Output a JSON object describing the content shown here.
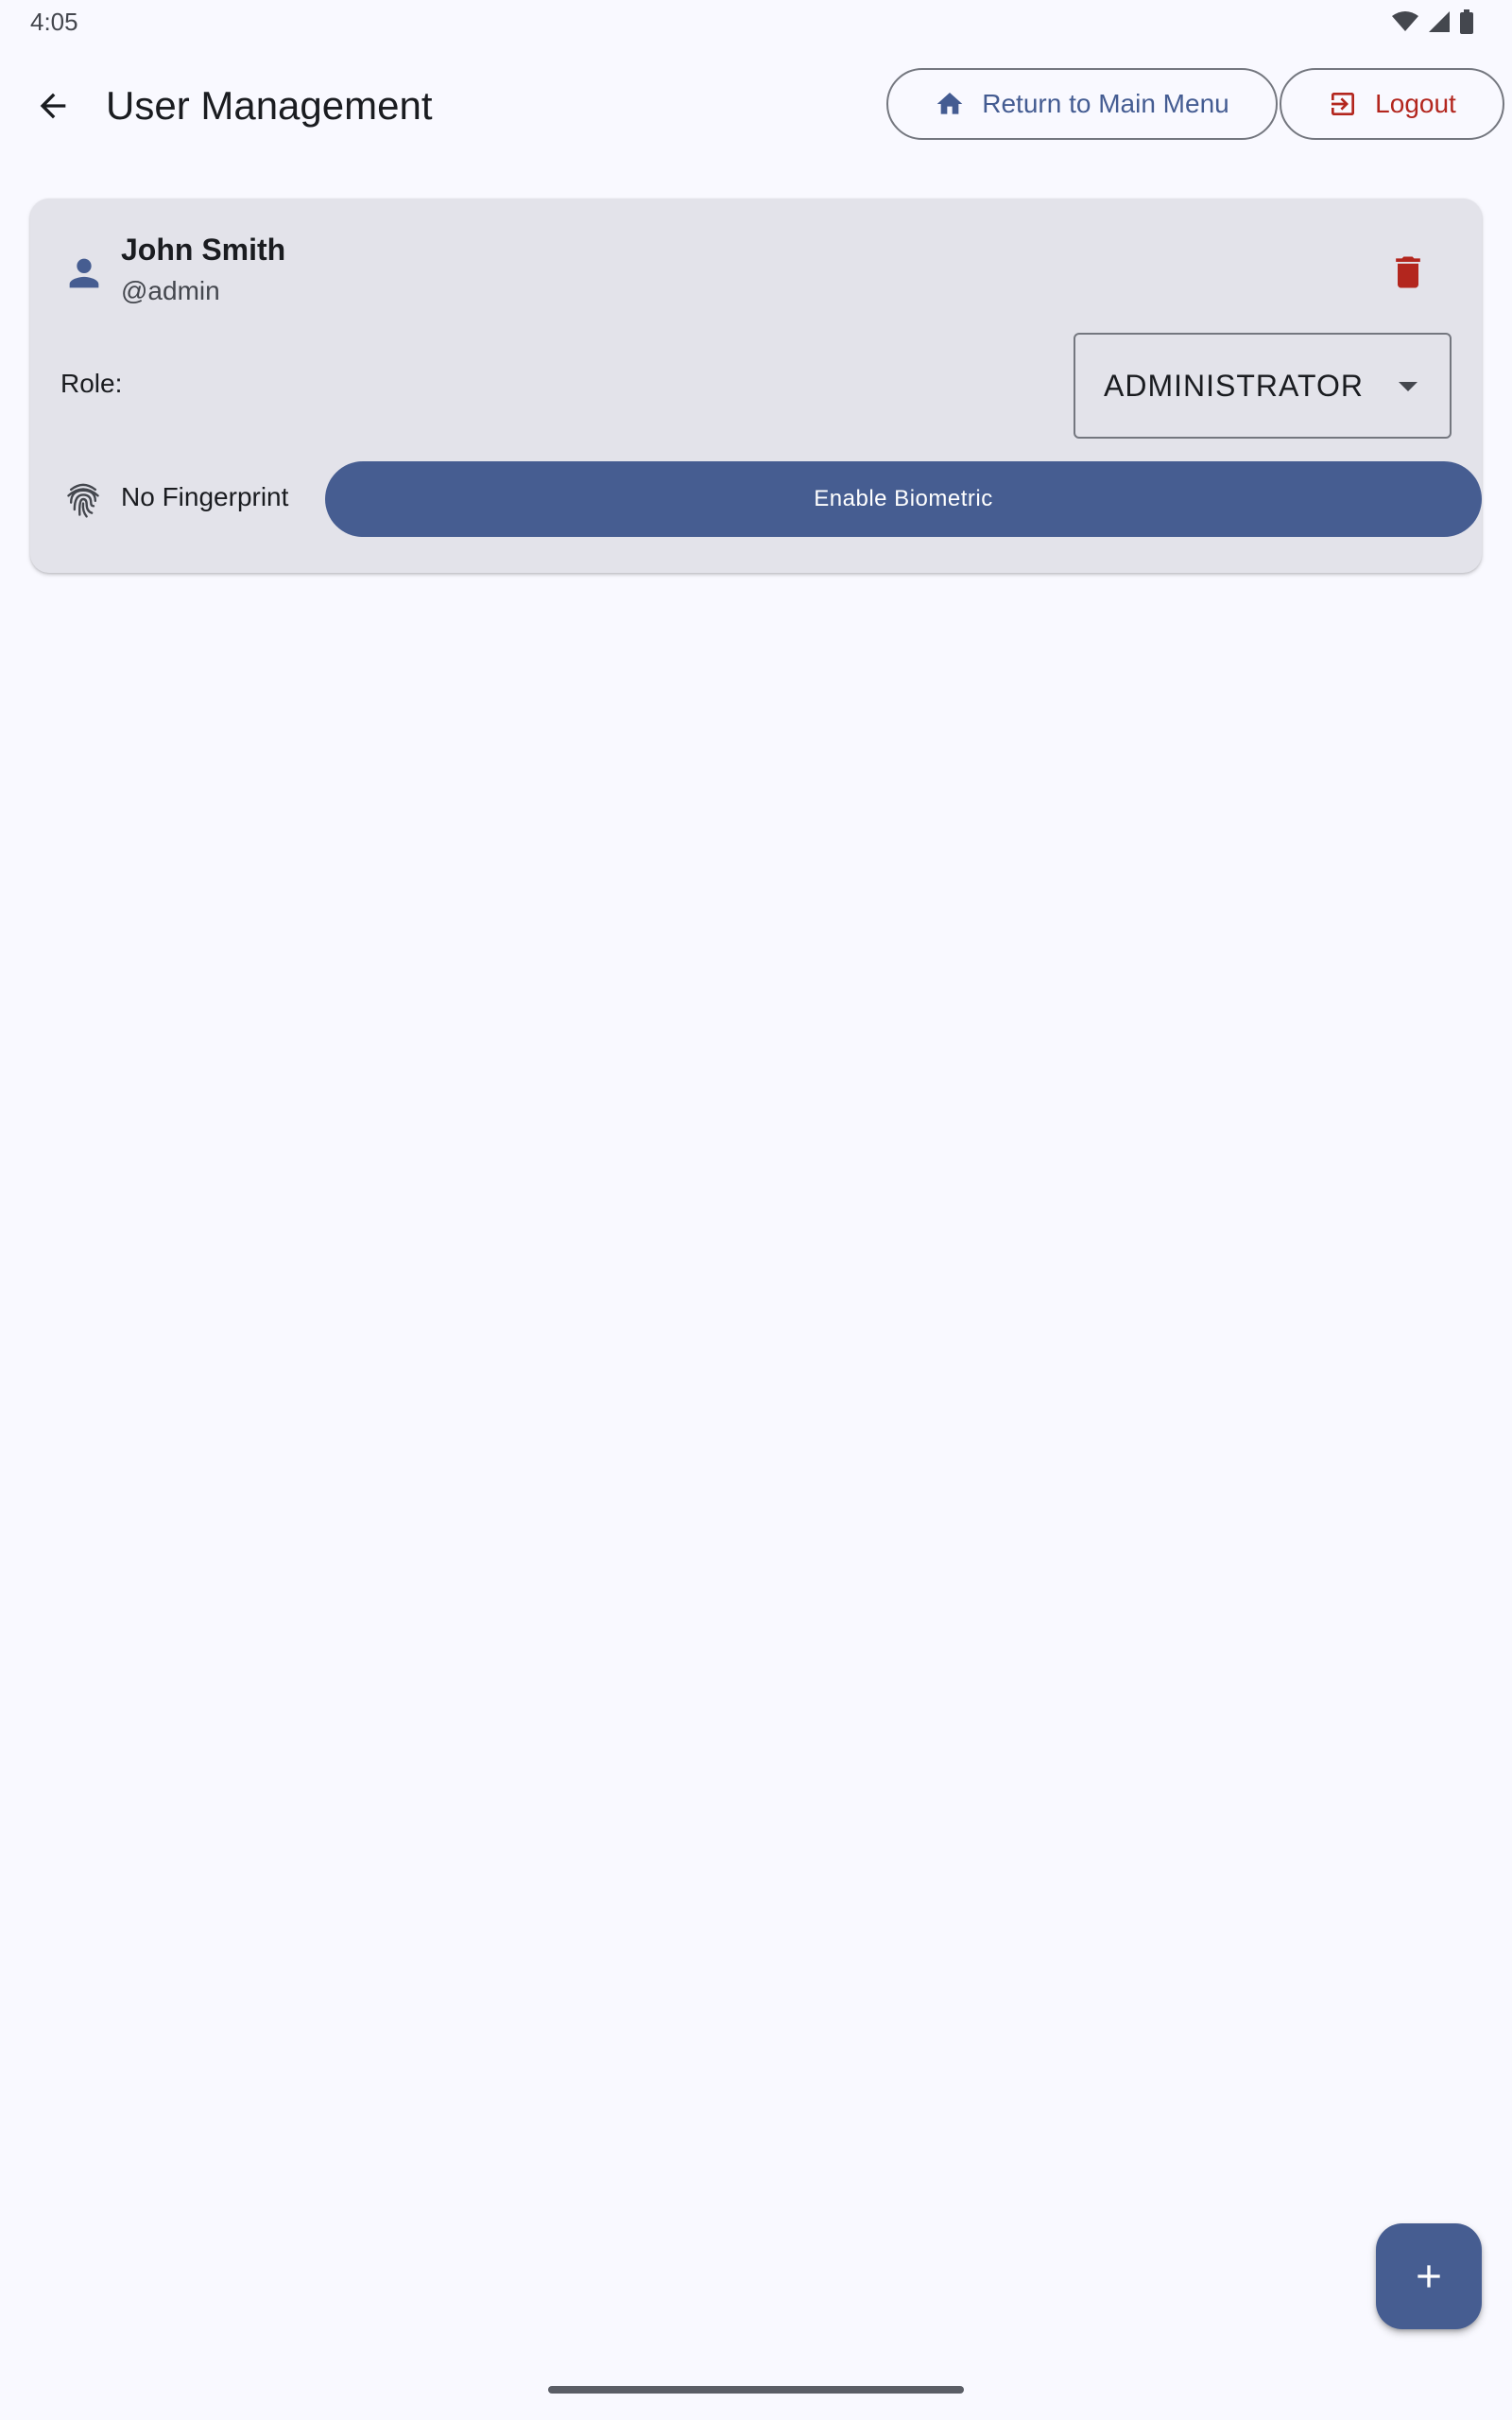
{
  "status_bar": {
    "time": "4:05",
    "icons": [
      "wifi-icon",
      "cellular-signal-icon",
      "battery-icon"
    ]
  },
  "app_bar": {
    "title": "User Management",
    "back_icon": "arrow-back-icon",
    "main_menu_button": {
      "label": "Return to Main Menu",
      "icon": "home-icon"
    },
    "logout_button": {
      "label": "Logout",
      "icon": "logout-icon"
    }
  },
  "users": [
    {
      "name": "John Smith",
      "handle": "@admin",
      "icon": "person-icon",
      "delete_icon": "trash-icon",
      "role_label": "Role:",
      "role_value": "ADMINISTRATOR",
      "fingerprint_status": "No Fingerprint",
      "fingerprint_icon": "fingerprint-icon",
      "biometric_button": "Enable Biometric"
    }
  ],
  "fab": {
    "icon": "add-icon"
  },
  "colors": {
    "primary": "#465d91",
    "danger": "#b3261e",
    "background": "#f9f9ff",
    "card": "#e3e3ea",
    "outline": "#74777f"
  }
}
